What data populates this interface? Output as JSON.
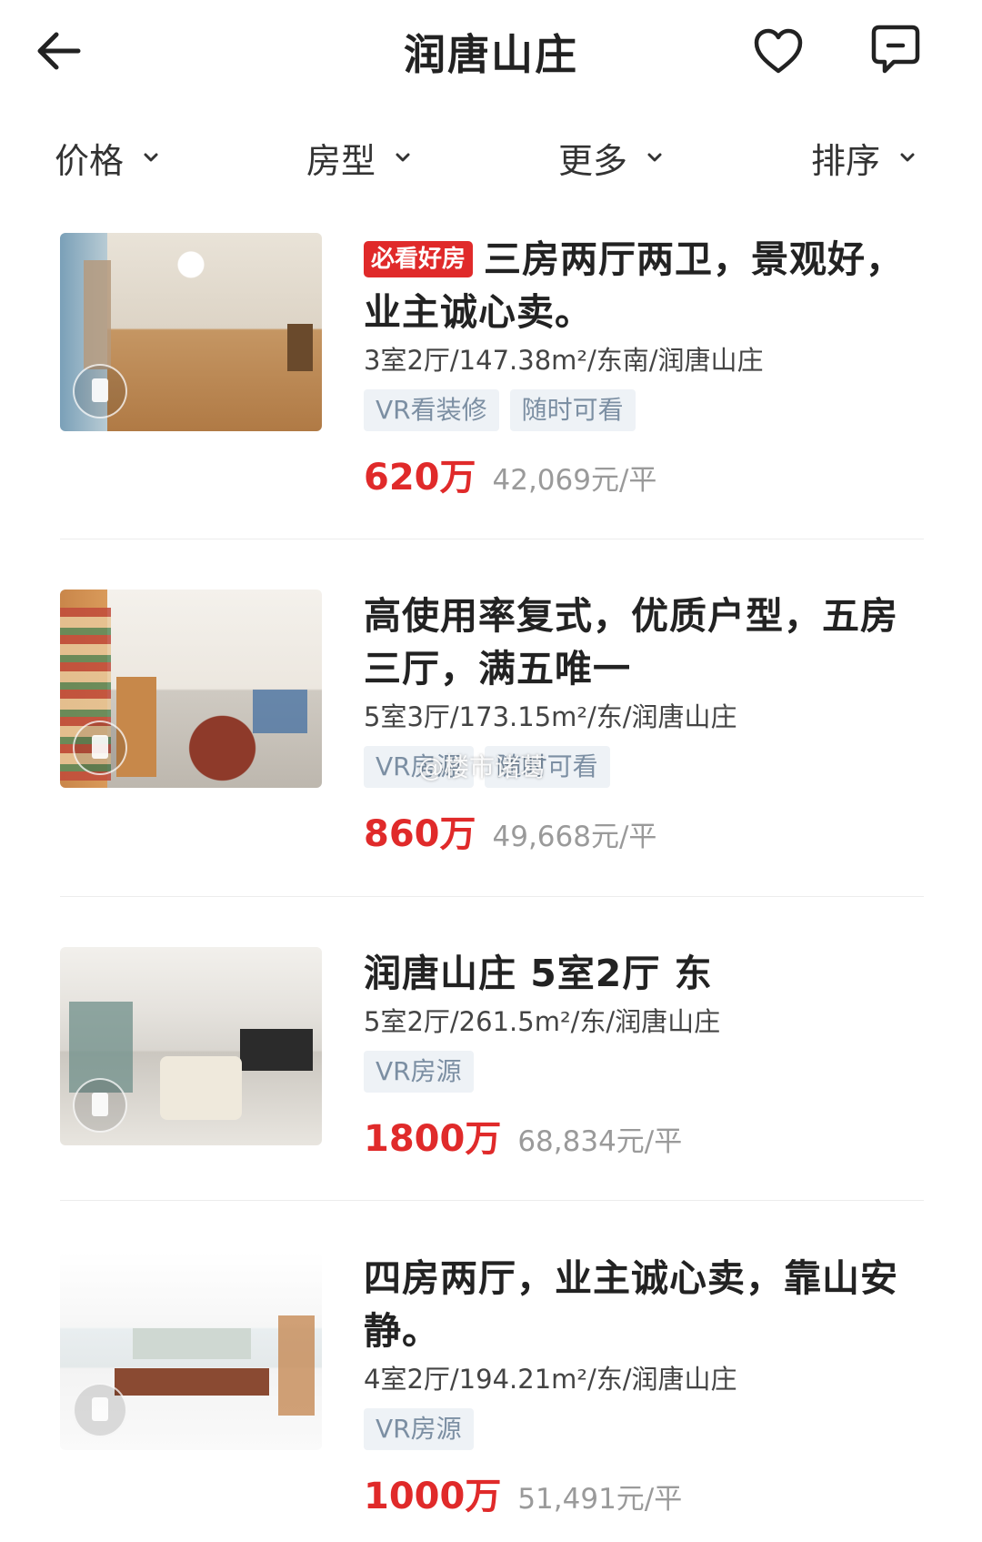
{
  "header": {
    "title": "润唐山庄",
    "back_icon": "arrow-left-icon",
    "favorite_icon": "heart-icon",
    "message_icon": "chat-bubble-icon"
  },
  "filters": [
    {
      "label": "价格"
    },
    {
      "label": "房型"
    },
    {
      "label": "更多"
    },
    {
      "label": "排序"
    }
  ],
  "listings": [
    {
      "badge": "必看好房",
      "title": "三房两厅两卫，景观好，业主诚心卖。",
      "spec": "3室2厅/147.38m²/东南/润唐山庄",
      "tags": [
        "VR看装修",
        "随时可看"
      ],
      "price": "620万",
      "unit_price": "42,069元/平"
    },
    {
      "badge": "",
      "title": "高使用率复式，优质户型，五房三厅，满五唯一",
      "spec": "5室3厅/173.15m²/东/润唐山庄",
      "tags": [
        "VR房源",
        "随时可看"
      ],
      "price": "860万",
      "unit_price": "49,668元/平"
    },
    {
      "badge": "",
      "title": "润唐山庄 5室2厅 东",
      "spec": "5室2厅/261.5m²/东/润唐山庄",
      "tags": [
        "VR房源"
      ],
      "price": "1800万",
      "unit_price": "68,834元/平"
    },
    {
      "badge": "",
      "title": "四房两厅，业主诚心卖，靠山安静。",
      "spec": "4室2厅/194.21m²/东/润唐山庄",
      "tags": [
        "VR房源"
      ],
      "price": "1000万",
      "unit_price": "51,491元/平"
    }
  ],
  "watermark": "@楼市诸葛",
  "colors": {
    "price": "#e02a2a",
    "tag_bg": "#eef2f6",
    "tag_text": "#7c8fa3"
  }
}
